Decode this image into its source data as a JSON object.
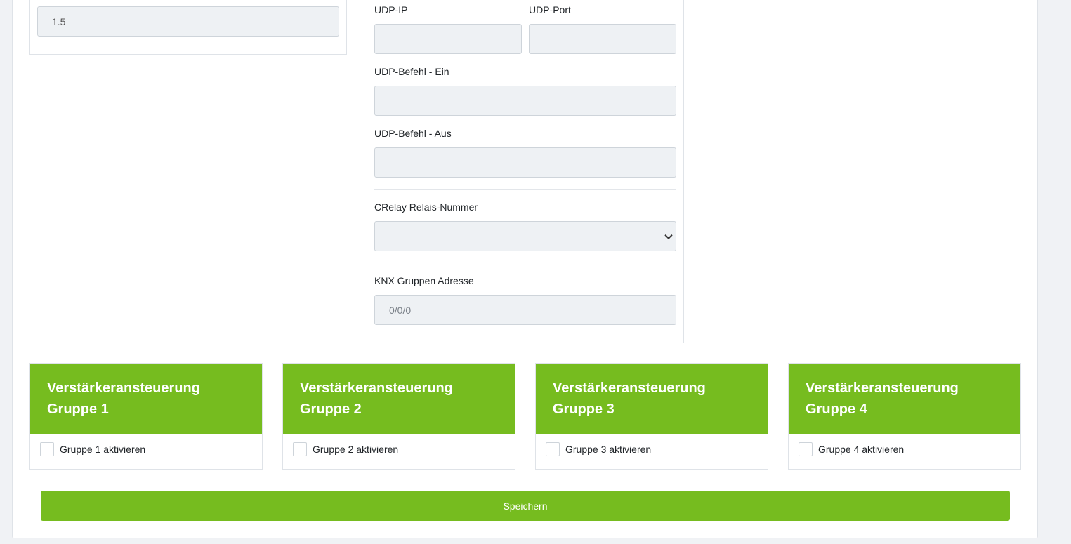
{
  "left_card": {
    "value": "1.5"
  },
  "udp": {
    "ip_label": "UDP-IP",
    "ip_value": "",
    "port_label": "UDP-Port",
    "port_value": "",
    "cmd_on_label": "UDP-Befehl - Ein",
    "cmd_on_value": "",
    "cmd_off_label": "UDP-Befehl - Aus",
    "cmd_off_value": ""
  },
  "crelay": {
    "label": "CRelay Relais-Nummer",
    "selected": ""
  },
  "knx": {
    "label": "KNX Gruppen Adresse",
    "placeholder": "0/0/0"
  },
  "groups": [
    {
      "title": "Verstärkeransteuerung Gruppe 1",
      "checkbox_label": "Gruppe 1 aktivieren",
      "checked": false
    },
    {
      "title": "Verstärkeransteuerung Gruppe 2",
      "checkbox_label": "Gruppe 2 aktivieren",
      "checked": false
    },
    {
      "title": "Verstärkeransteuerung Gruppe 3",
      "checkbox_label": "Gruppe 3 aktivieren",
      "checked": false
    },
    {
      "title": "Verstärkeransteuerung Gruppe 4",
      "checkbox_label": "Gruppe 4 aktivieren",
      "checked": false
    }
  ],
  "save_label": "Speichern",
  "colors": {
    "accent": "#76bc1f",
    "input_bg": "#eef1f4",
    "page_bg": "#f0f2f5"
  }
}
